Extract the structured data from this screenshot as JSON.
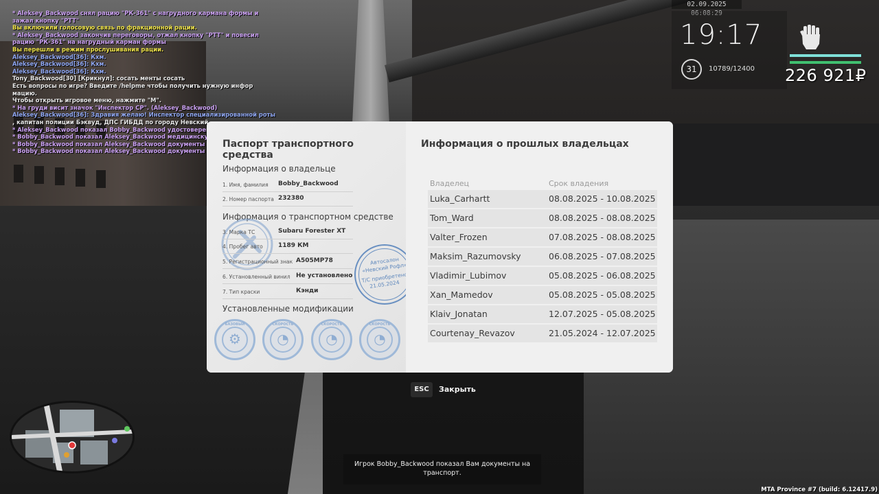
{
  "chat": [
    {
      "text": "* Aleksey_Backwood снял рацию \"РК-361\" с нагрудного кармана формы и",
      "color": "purple"
    },
    {
      "text": "  зажал кнопку \"PTT\"",
      "color": "purple"
    },
    {
      "text": "Вы включили голосовую связь по фракционной рации.",
      "color": "yellow"
    },
    {
      "text": "* Aleksey_Backwood закончив переговоры, отжал кнопку \"PTT\" и повесил",
      "color": "purple"
    },
    {
      "text": "рацию \"РК-361\" на нагрудный карман формы",
      "color": "purple"
    },
    {
      "text": "Вы перешли в режим прослушивания рации.",
      "color": "yellow"
    },
    {
      "text": "Aleksey_Backwood[36]: Кхм.",
      "color": "blue"
    },
    {
      "text": "Aleksey_Backwood[36]: Кхм.",
      "color": "blue"
    },
    {
      "text": "Aleksey_Backwood[36]: Кхм.",
      "color": "blue"
    },
    {
      "text": "Tony_Backwood[30] [Крикнул]: сосать менты сосать",
      "color": "white"
    },
    {
      "text": "Есть вопросы по игре? Введите /helpme чтобы получить нужную инфор",
      "color": "white"
    },
    {
      "text": "мацию.",
      "color": "white"
    },
    {
      "text": "Чтобы открыть игровое меню, нажмите \"M\".",
      "color": "white"
    },
    {
      "text": "* На груди висит значок \"Инспектор СР\". (Aleksey_Backwood)",
      "color": "purple"
    },
    {
      "text": "Aleksey_Backwood[36]: Здравия желаю! Инспектор специализированной роты",
      "color": "blue"
    },
    {
      "text": ", капитан полиции Бэквуд, ДПС ГИБДД по городу Невский.",
      "color": "white"
    },
    {
      "text": "* Aleksey_Backwood показал Bobby_Backwood удостоверение",
      "color": "purple"
    },
    {
      "text": "* Bobby_Backwood показал Aleksey_Backwood медицинскую карту",
      "color": "purple"
    },
    {
      "text": "* Bobby_Backwood показал Aleksey_Backwood документы на транспорт",
      "color": "purple"
    },
    {
      "text": "* Bobby_Backwood показал Aleksey_Backwood документы на транспорт",
      "color": "purple"
    }
  ],
  "hud": {
    "datetime": "02.09.2025 06:08:29",
    "time": "19:17",
    "level": "31",
    "xp": "10789/12400",
    "money": "226 921₽",
    "icon": "fist-icon"
  },
  "passport": {
    "title": "Паспорт транспортного средства",
    "owner_section": "Информация о владельце",
    "owner_fields": [
      {
        "label": "1. Имя, фамилия",
        "value": "Bobby_Backwood"
      },
      {
        "label": "2. Номер паспорта",
        "value": "232380"
      }
    ],
    "vehicle_section": "Информация о транспортном средстве",
    "vehicle_fields": [
      {
        "label": "3. Марка ТС",
        "value": "Subaru Forester XT"
      },
      {
        "label": "4. Пробег авто",
        "value": "1189 КМ"
      },
      {
        "label": "5. Регистрационный знак",
        "value": "A505MP78"
      },
      {
        "label": "6. Установленный винил",
        "value": "Не установлено"
      },
      {
        "label": "7. Тип краски",
        "value": "Кэнди"
      }
    ],
    "stamp": {
      "line1": "Автосалон",
      "line2": "«Невский Рофл»",
      "line3": "Т/С приобретено",
      "line4": "21.05.2024"
    },
    "mods_section": "Установленные модификации",
    "mods": [
      {
        "label": "БАЗОВЫЙ",
        "icon": "gear-icon"
      },
      {
        "label": "СКОРОСТЬ",
        "icon": "speedometer-icon"
      },
      {
        "label": "СКОРОСТЬ",
        "icon": "speedometer-icon"
      },
      {
        "label": "СКОРОСТЬ",
        "icon": "speedometer-icon"
      }
    ]
  },
  "owners": {
    "title": "Информация о прошлых владельцах",
    "col_owner": "Владелец",
    "col_period": "Срок владения",
    "rows": [
      {
        "name": "Luka_Carhartt",
        "period": "08.08.2025 - 10.08.2025"
      },
      {
        "name": "Tom_Ward",
        "period": "08.08.2025 - 08.08.2025"
      },
      {
        "name": "Valter_Frozen",
        "period": "07.08.2025 - 08.08.2025"
      },
      {
        "name": "Maksim_Razumovsky",
        "period": "06.08.2025 - 07.08.2025"
      },
      {
        "name": "Vladimir_Lubimov",
        "period": "05.08.2025 - 06.08.2025"
      },
      {
        "name": "Xan_Mamedov",
        "period": "05.08.2025 - 05.08.2025"
      },
      {
        "name": "Klaiv_Jonatan",
        "period": "12.07.2025 - 05.08.2025"
      },
      {
        "name": "Courtenay_Revazov",
        "period": "21.05.2024 - 12.07.2025"
      }
    ]
  },
  "close": {
    "key": "ESC",
    "label": "Закрыть"
  },
  "notification": "Игрок Bobby_Backwood показал Вам документы на транспорт.",
  "build": "MTA Province #7 (build: 6.12417.9)",
  "colors": {
    "hp": "#7fe0d8",
    "armor": "#40c070",
    "stamp": "#5b86bd"
  }
}
